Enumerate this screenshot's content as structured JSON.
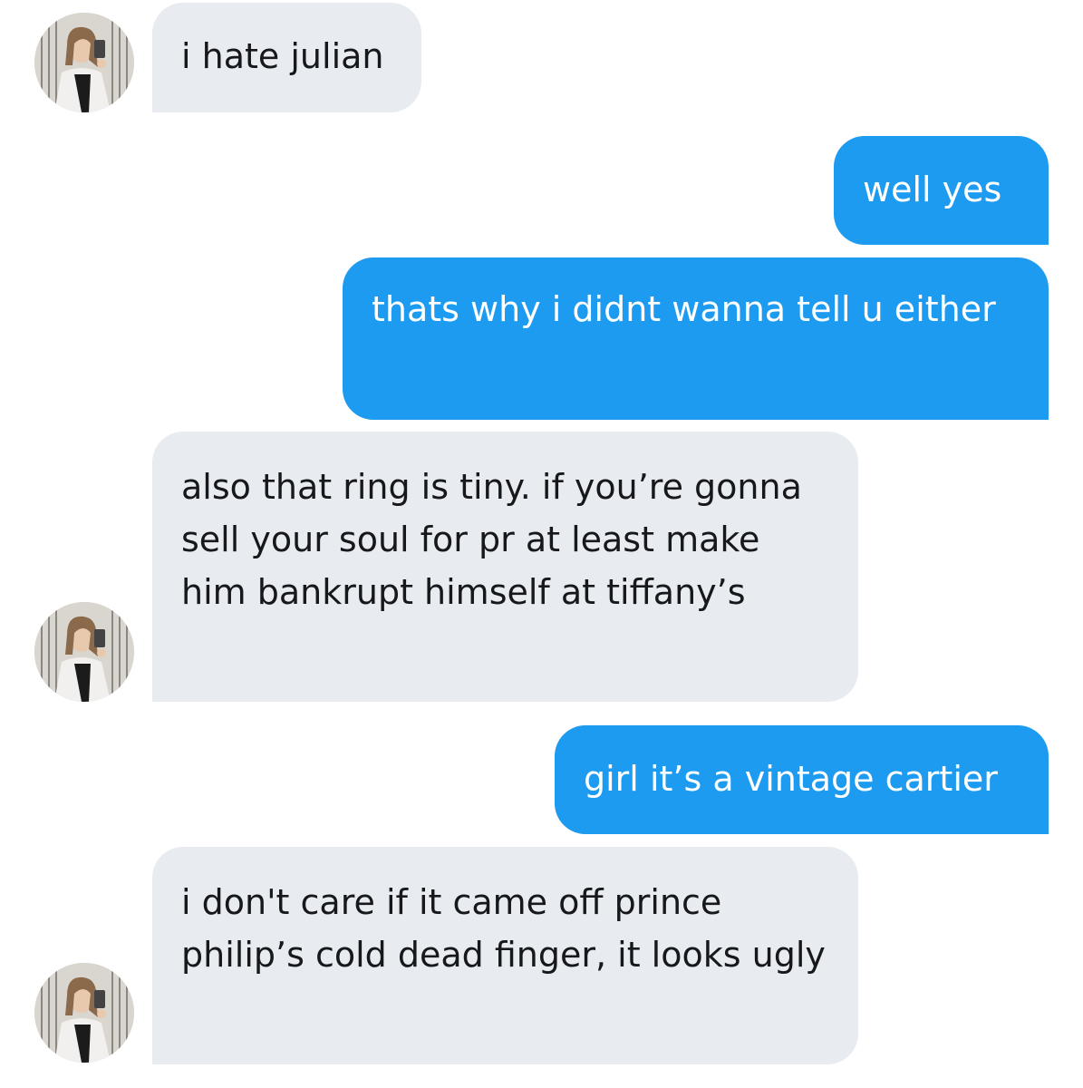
{
  "conversation": {
    "messages": [
      {
        "direction": "incoming",
        "text": "i hate julian",
        "avatar": "avatar-photo"
      },
      {
        "direction": "outgoing",
        "text": "well yes"
      },
      {
        "direction": "outgoing",
        "text": "thats why i didnt wanna tell u either"
      },
      {
        "direction": "incoming",
        "text": "also that ring is tiny. if you’re gonna sell your soul for pr at least make him bankrupt himself at tiffany’s",
        "avatar": "avatar-photo"
      },
      {
        "direction": "outgoing",
        "text": "girl it’s a vintage cartier"
      },
      {
        "direction": "incoming",
        "text": "i don't care if it came off prince philip’s cold dead finger, it looks ugly",
        "avatar": "avatar-photo"
      }
    ]
  },
  "colors": {
    "incoming_bubble": "#e8ebf0",
    "outgoing_bubble": "#1d9bf0",
    "incoming_text": "#16181c",
    "outgoing_text": "#ffffff",
    "background": "#ffffff"
  }
}
